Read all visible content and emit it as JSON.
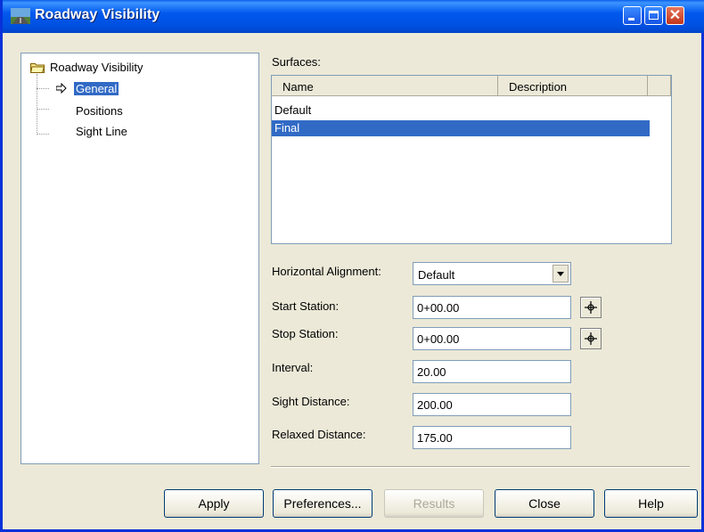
{
  "window": {
    "title": "Roadway Visibility"
  },
  "tree": {
    "root_label": "Roadway Visibility",
    "items": [
      {
        "label": "General",
        "selected": true
      },
      {
        "label": "Positions",
        "selected": false
      },
      {
        "label": "Sight Line",
        "selected": false
      }
    ]
  },
  "surfaces": {
    "label": "Surfaces:",
    "columns": [
      "Name",
      "Description",
      ""
    ],
    "rows": [
      {
        "name": "Default",
        "description": "",
        "selected": false
      },
      {
        "name": "Final",
        "description": "",
        "selected": true
      }
    ]
  },
  "form": {
    "horizontal_alignment": {
      "label": "Horizontal Alignment:",
      "value": "Default"
    },
    "start_station": {
      "label": "Start Station:",
      "value": "0+00.00"
    },
    "stop_station": {
      "label": "Stop Station:",
      "value": "0+00.00"
    },
    "interval": {
      "label": "Interval:",
      "value": "20.00"
    },
    "sight_distance": {
      "label": "Sight Distance:",
      "value": "200.00"
    },
    "relaxed_distance": {
      "label": "Relaxed Distance:",
      "value": "175.00"
    }
  },
  "buttons": {
    "apply": "Apply",
    "preferences": "Preferences...",
    "results": "Results",
    "close": "Close",
    "help": "Help"
  },
  "icons": {
    "title": "road-icon",
    "tree_root": "folder-icon",
    "tree_pointer": "arrow-icon",
    "pick_station": "crosshair-icon",
    "dropdown": "chevron-down-icon"
  },
  "colors": {
    "titlebar": "#0054e3",
    "selection": "#316ac5",
    "dialog": "#ece9d8"
  }
}
